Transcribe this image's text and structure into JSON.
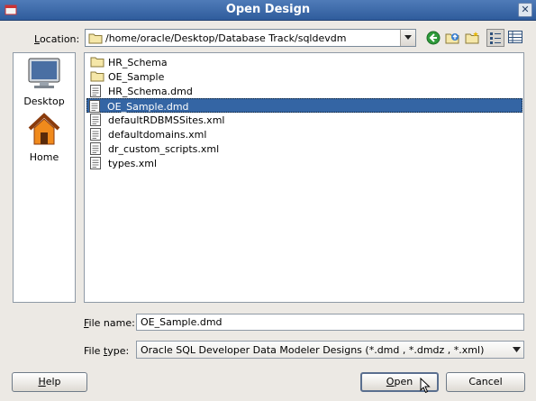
{
  "window": {
    "title": "Open Design",
    "close_glyph": "✕"
  },
  "location": {
    "label": "Location:",
    "path": "/home/oracle/Desktop/Database Track/sqldevdm"
  },
  "toolbar": {
    "icons": [
      "back-icon",
      "up-folder-icon",
      "new-folder-icon",
      "list-view-icon",
      "details-view-icon"
    ],
    "active_view": "list"
  },
  "places": [
    {
      "label": "Desktop",
      "icon": "desktop-icon"
    },
    {
      "label": "Home",
      "icon": "home-icon"
    }
  ],
  "files": [
    {
      "name": "HR_Schema",
      "type": "folder",
      "selected": false
    },
    {
      "name": "OE_Sample",
      "type": "folder",
      "selected": false
    },
    {
      "name": "HR_Schema.dmd",
      "type": "file",
      "selected": false
    },
    {
      "name": "OE_Sample.dmd",
      "type": "file",
      "selected": true
    },
    {
      "name": "defaultRDBMSSites.xml",
      "type": "file",
      "selected": false
    },
    {
      "name": "defaultdomains.xml",
      "type": "file",
      "selected": false
    },
    {
      "name": "dr_custom_scripts.xml",
      "type": "file",
      "selected": false
    },
    {
      "name": "types.xml",
      "type": "file",
      "selected": false
    }
  ],
  "file_name": {
    "label": "File name:",
    "value": "OE_Sample.dmd"
  },
  "file_type": {
    "label": "File type:",
    "value": "Oracle SQL Developer Data Modeler Designs (*.dmd , *.dmdz , *.xml)"
  },
  "buttons": {
    "help": "Help",
    "open": "Open",
    "cancel": "Cancel"
  },
  "colors": {
    "selection": "#3465a4",
    "titlebar": "#3b68a8"
  }
}
